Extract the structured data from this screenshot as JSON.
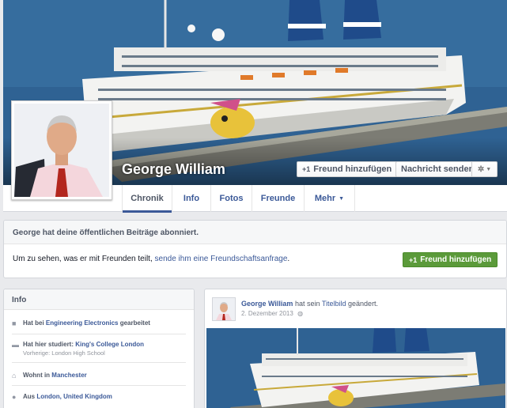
{
  "profile": {
    "name": "George William",
    "add_friend_label": "Freund hinzufügen",
    "message_label": "Nachricht senden"
  },
  "tabs": [
    {
      "label": "Chronik"
    },
    {
      "label": "Info"
    },
    {
      "label": "Fotos"
    },
    {
      "label": "Freunde"
    },
    {
      "label": "Mehr"
    }
  ],
  "subscribe": {
    "notice": "George hat deine öffentlichen Beiträge abonniert.",
    "body_prefix": "Um zu sehen, was er mit Freunden teilt,",
    "body_link": "sende ihm eine Freundschaftsanfrage",
    "button": "Freund hinzufügen"
  },
  "info": {
    "title": "Info",
    "work_prefix": "Hat bei",
    "work_place": "Engineering Electronics",
    "work_suffix": "gearbeitet",
    "study_prefix": "Hat hier studiert:",
    "study_place": "King's College London",
    "study_previous": "Vorherige: London High School",
    "lives_prefix": "Wohnt in",
    "lives_place": "Manchester",
    "from_prefix": "Aus",
    "from_place": "London, United Kingdom"
  },
  "post": {
    "author": "George William",
    "action_prefix": "hat sein",
    "action_link": "Titelbild",
    "action_suffix": "geändert.",
    "date": "2. Dezember 2013"
  },
  "icons": {
    "add_friend": "add-friend-icon",
    "gear": "gear-icon",
    "dropdown": "chevron-down-icon",
    "work": "briefcase-icon",
    "study": "graduation-cap-icon",
    "home": "home-icon",
    "location": "location-pin-icon",
    "audience": "globe-icon"
  },
  "colors": {
    "link": "#3b5998",
    "green_button": "#5b9a3a",
    "background": "#e9eaed"
  }
}
